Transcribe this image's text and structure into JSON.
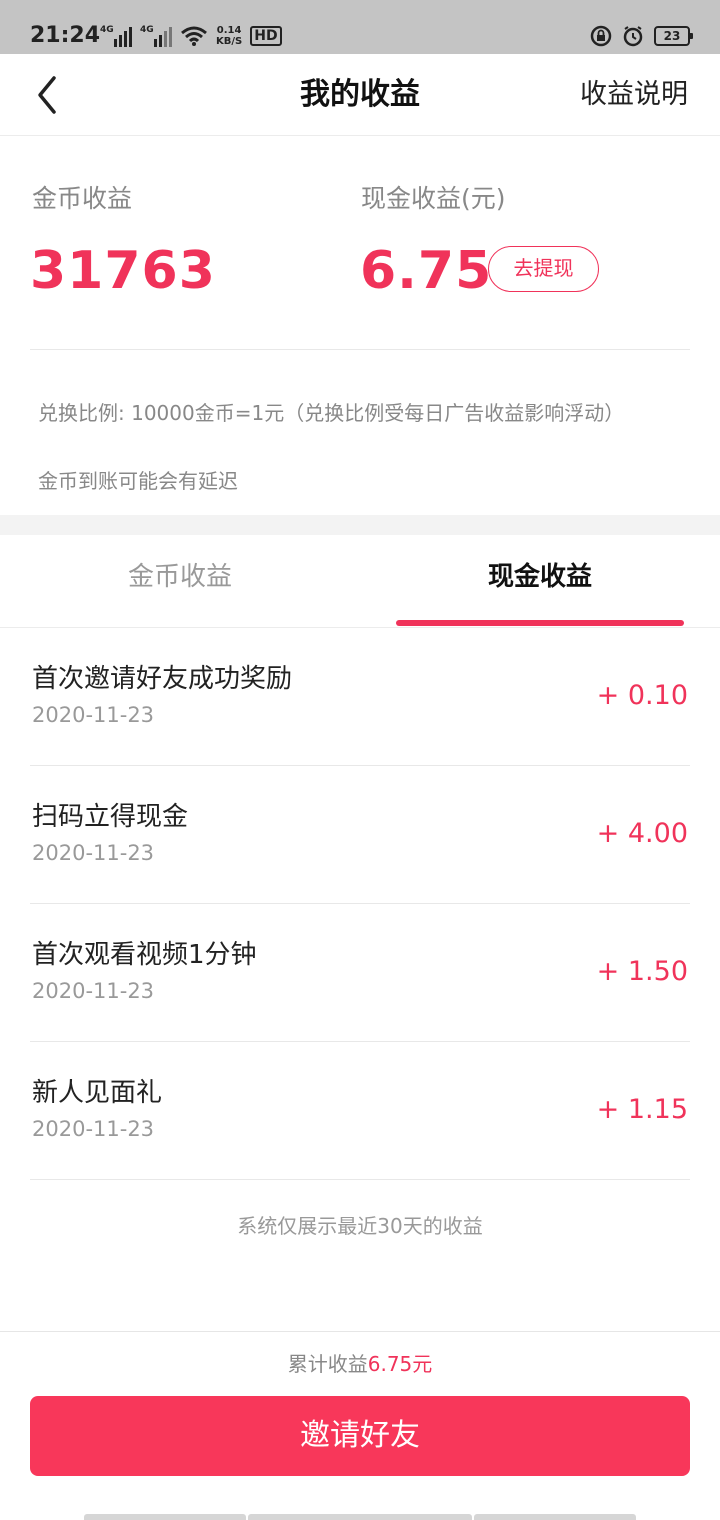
{
  "status_bar": {
    "time": "21:24",
    "network_1": "4G",
    "network_2": "4G",
    "speed_value": "0.14",
    "speed_unit": "KB/S",
    "hd": "HD",
    "battery": "23",
    "icons": [
      "signal-icon",
      "wifi-icon",
      "rotation-lock-icon",
      "alarm-icon",
      "battery-icon"
    ]
  },
  "nav": {
    "title": "我的收益",
    "right_link": "收益说明",
    "back_icon": "chevron-left-icon"
  },
  "summary": {
    "coin_label": "金币收益",
    "coin_value": "31763",
    "cash_label": "现金收益(元)",
    "cash_value": "6.75",
    "withdraw_label": "去提现",
    "note_ratio": "兑换比例: 10000金币=1元（兑换比例受每日广告收益影响浮动）",
    "note_delay": "金币到账可能会有延迟"
  },
  "tabs": [
    {
      "label": "金币收益",
      "active": false
    },
    {
      "label": "现金收益",
      "active": true
    }
  ],
  "records": [
    {
      "title": "首次邀请好友成功奖励",
      "date": "2020-11-23",
      "amount": "+ 0.10"
    },
    {
      "title": "扫码立得现金",
      "date": "2020-11-23",
      "amount": "+ 4.00"
    },
    {
      "title": "首次观看视频1分钟",
      "date": "2020-11-23",
      "amount": "+ 1.50"
    },
    {
      "title": "新人见面礼",
      "date": "2020-11-23",
      "amount": "+ 1.15"
    }
  ],
  "footnote": "系统仅展示最近30天的收益",
  "bottom": {
    "total_prefix": "累计收益",
    "total_amount": "6.75元",
    "invite_label": "邀请好友"
  },
  "colors": {
    "accent": "#f0335a",
    "button": "#f8375a",
    "muted_text": "#999999"
  }
}
